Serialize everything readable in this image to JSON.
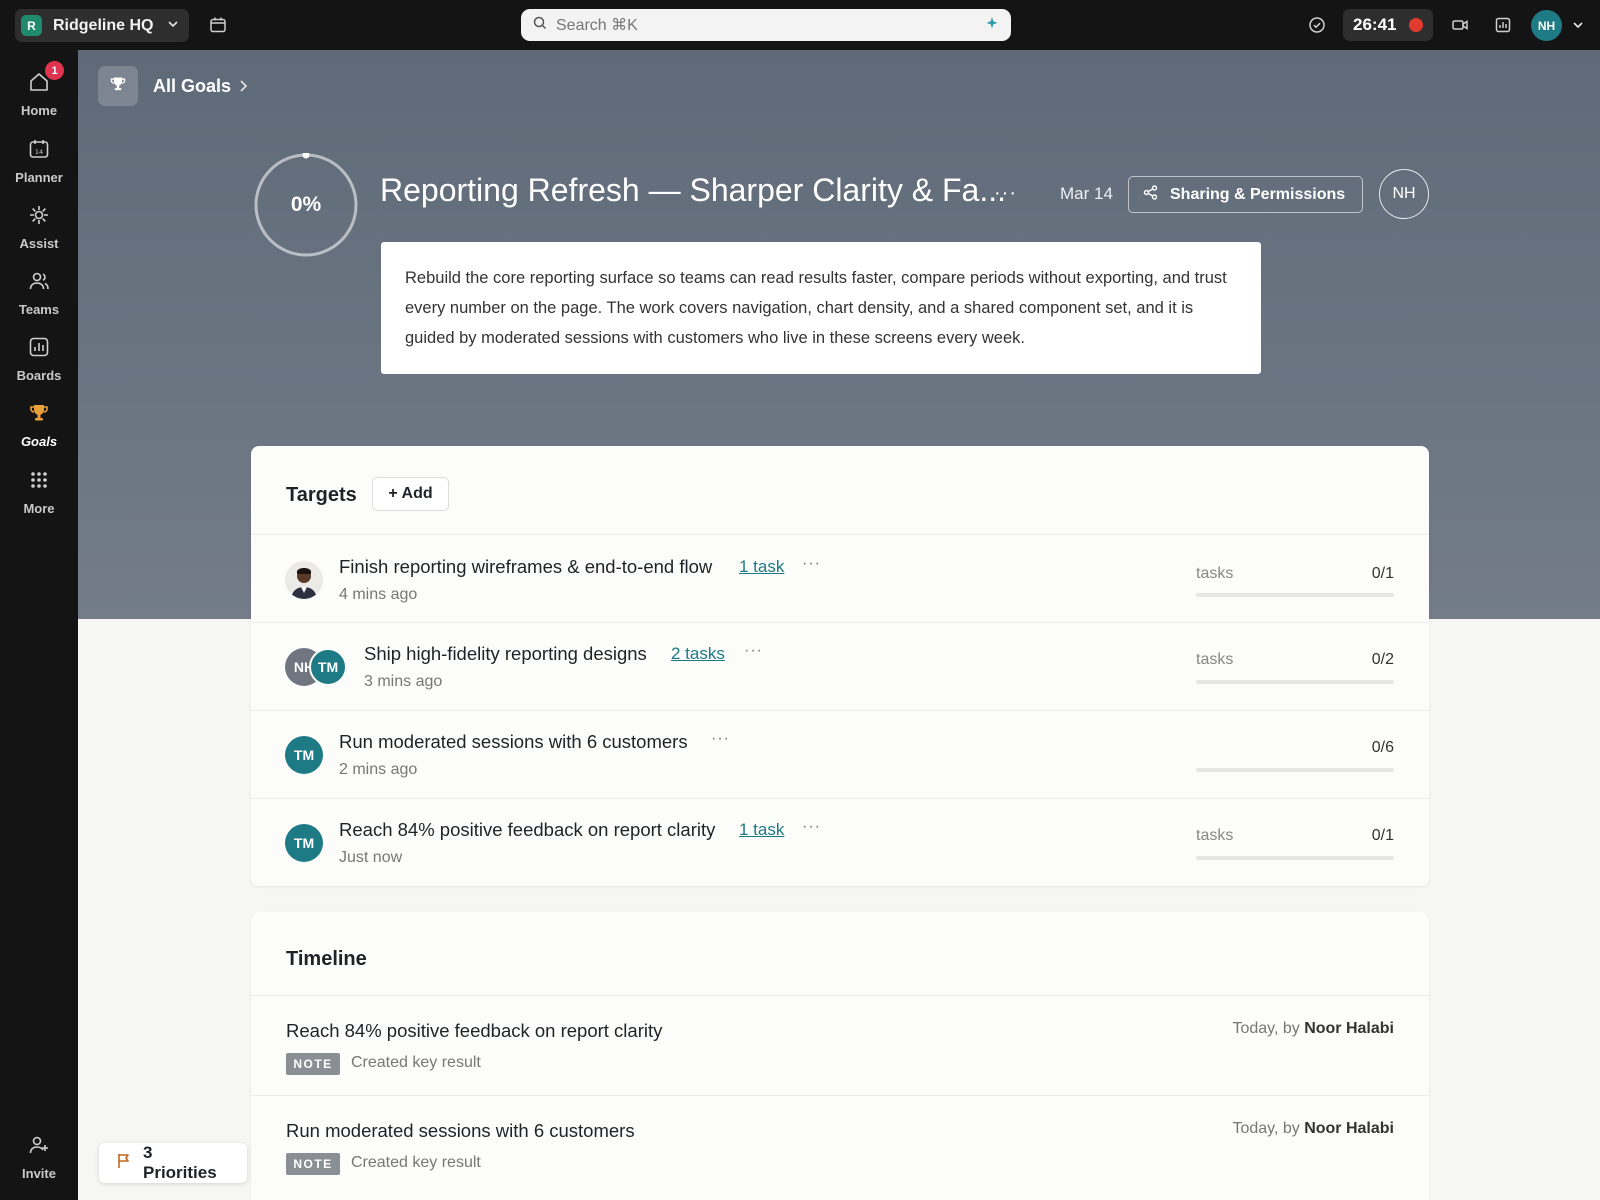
{
  "topbar": {
    "workspace_initial": "R",
    "workspace_name": "Ridgeline HQ",
    "search_placeholder": "Search ⌘K",
    "timer": "26:41",
    "user_initials": "NH"
  },
  "sidebar": {
    "items": [
      {
        "label": "Home",
        "badge": "1",
        "icon": "home-icon"
      },
      {
        "label": "Planner",
        "icon": "calendar-icon"
      },
      {
        "label": "Assist",
        "icon": "sparkle-icon"
      },
      {
        "label": "Teams",
        "icon": "people-icon"
      },
      {
        "label": "Boards",
        "icon": "chart-icon"
      },
      {
        "label": "Goals",
        "icon": "trophy-icon",
        "active": true
      },
      {
        "label": "More",
        "icon": "grid-icon"
      }
    ],
    "invite_label": "Invite"
  },
  "breadcrumb": {
    "label": "All Goals"
  },
  "goal": {
    "progress_percent": 0,
    "progress_label": "0%",
    "title": "Reporting Refresh — Sharper Clarity & Fa...",
    "due_date": "Mar 14",
    "share_label": "Sharing & Permissions",
    "owner_initials": "NH",
    "description": "Rebuild the core reporting surface so teams can read results faster, compare periods without exporting, and trust every number on the page. The work covers navigation, chart density, and a shared component set, and it is guided by moderated sessions with customers who live in these screens every week."
  },
  "targets": {
    "title": "Targets",
    "add_label": "+ Add",
    "rows": [
      {
        "title": "Finish reporting wireframes & end-to-end flow",
        "link": "1 task",
        "time": "4 mins ago",
        "metric_label": "tasks",
        "value": "0/1",
        "progress": 0,
        "avatars": [
          "photo"
        ]
      },
      {
        "title": "Ship high-fidelity reporting designs",
        "link": "2 tasks",
        "time": "3 mins ago",
        "metric_label": "tasks",
        "value": "0/2",
        "progress": 0,
        "avatars": [
          "NH",
          "TM"
        ]
      },
      {
        "title": "Run moderated sessions with 6 customers",
        "link": "",
        "time": "2 mins ago",
        "metric_label": "",
        "value": "0/6",
        "progress": 0,
        "avatars": [
          "TM"
        ]
      },
      {
        "title": "Reach 84% positive feedback on report clarity",
        "link": "1 task",
        "time": "Just now",
        "metric_label": "tasks",
        "value": "0/1",
        "progress": 0,
        "avatars": [
          "TM"
        ]
      }
    ]
  },
  "timeline": {
    "title": "Timeline",
    "entries": [
      {
        "title": "Reach 84% positive feedback on report clarity",
        "tag": "NOTE",
        "desc": "Created key result",
        "when": "Today, by",
        "who": "Noor Halabi"
      },
      {
        "title": "Run moderated sessions with 6 customers",
        "tag": "NOTE",
        "desc": "Created key result",
        "when": "Today, by",
        "who": "Noor Halabi"
      }
    ]
  },
  "priorities": {
    "label": "3 Priorities"
  },
  "colors": {
    "accent": "#1e7a84",
    "badge": "#e0334f",
    "record": "#e23b2e"
  }
}
